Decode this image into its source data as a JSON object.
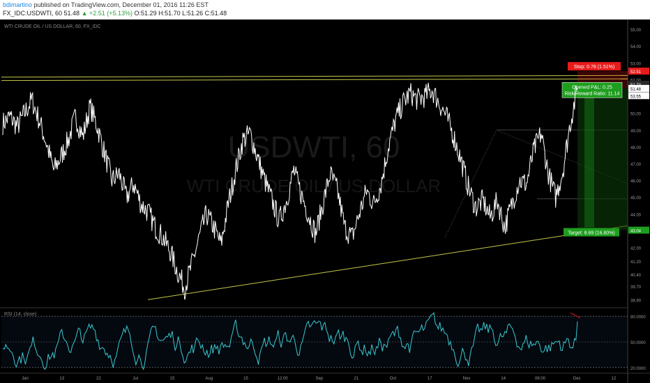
{
  "header": {
    "author": "bdimartino",
    "published_text": "published on TradingView.com, December 01, 2016 11:26 EST",
    "symbol": "FX_IDC:USDWTI, 60",
    "last": "51.48",
    "change": "▲ +2.51 (+5.13%)",
    "ohlc": "O:51.29 H:51.70 L:51.26 C:51.48"
  },
  "chart": {
    "title": "WTI CRUDE OIL / US DOLLAR, 60, FX_IDC",
    "watermark_symbol": "USDWTI, 60",
    "watermark_name": "WTI CRUDE OIL / US DOLLAR",
    "rsi_label": "RSI (14, close)",
    "stop_label": "Stop: 0.78 (1.51%)",
    "opened_pl": "Opened P&L: 0.25",
    "risk_reward": "Risk/Reward Ratio: 11.14",
    "target_label": "Target: 8.69 (16.80%)",
    "price_tags": [
      "52.51",
      "51.73",
      "51.48",
      "53.55",
      "43.04"
    ],
    "rsi_ticks": [
      "80.0000",
      "50.0000",
      "20.0000"
    ],
    "colors": {
      "background": "#000000",
      "price_line": "#ffffff",
      "trendline": "#c8c84a",
      "rsi_line": "#3cc8d0",
      "stop": "#e81b1b",
      "target": "#1e9e1e"
    }
  },
  "chart_data": {
    "type": "line",
    "title": "WTI CRUDE OIL / US DOLLAR, 60, FX_IDC",
    "x": [
      "Jan",
      "13",
      "22",
      "Jul",
      "15",
      "Aug",
      "15",
      "12:00",
      "Sep",
      "21",
      "Oct",
      "17",
      "Nov",
      "14",
      "06:00",
      "Dec",
      "12"
    ],
    "y_ticks": [
      55.0,
      54.0,
      53.0,
      52.0,
      51.0,
      50.0,
      49.0,
      48.0,
      47.0,
      46.0,
      45.0,
      44.0,
      43.0,
      42.0,
      41.2,
      40.4,
      39.7,
      38.9
    ],
    "y_tick_labels": [
      "55.00",
      "54.00",
      "53.00",
      "52.00",
      "51.00",
      "50.00",
      "49.00",
      "48.00",
      "47.00",
      "46.00",
      "45.00",
      "44.00",
      "43.00",
      "42.00",
      "41.20",
      "40.40",
      "39.70",
      "38.90"
    ],
    "ylim": [
      38.5,
      55.5
    ],
    "series": [
      {
        "values": [
          49.4,
          49.8,
          49.2,
          50.0,
          50.8,
          49.6,
          48.2,
          46.6,
          47.4,
          48.4,
          49.8,
          48.6,
          50.4,
          49.2,
          47.6,
          46.0,
          46.4,
          45.0,
          45.8,
          44.6,
          44.1,
          43.2,
          42.6,
          41.8,
          40.6,
          39.6,
          41.0,
          42.6,
          44.0,
          43.2,
          42.2,
          44.6,
          46.6,
          48.4,
          48.8,
          47.4,
          46.0,
          44.8,
          43.6,
          44.8,
          46.6,
          45.2,
          44.0,
          42.8,
          44.6,
          46.4,
          45.4,
          43.2,
          42.6,
          44.0,
          45.4,
          44.6,
          45.8,
          48.0,
          49.6,
          50.6,
          51.2,
          50.8,
          51.0,
          51.4,
          50.6,
          49.8,
          48.6,
          47.2,
          45.6,
          44.4,
          44.8,
          43.8,
          44.8,
          43.2,
          44.6,
          46.0,
          45.8,
          47.8,
          48.8,
          46.4,
          45.0,
          46.6,
          49.4,
          51.5
        ]
      }
    ],
    "rsi": {
      "name": "RSI (14, close)",
      "levels": [
        80,
        50,
        20
      ],
      "ylim": [
        15,
        85
      ]
    },
    "annotations": {
      "stop": 52.51,
      "target": 43.04
    }
  }
}
